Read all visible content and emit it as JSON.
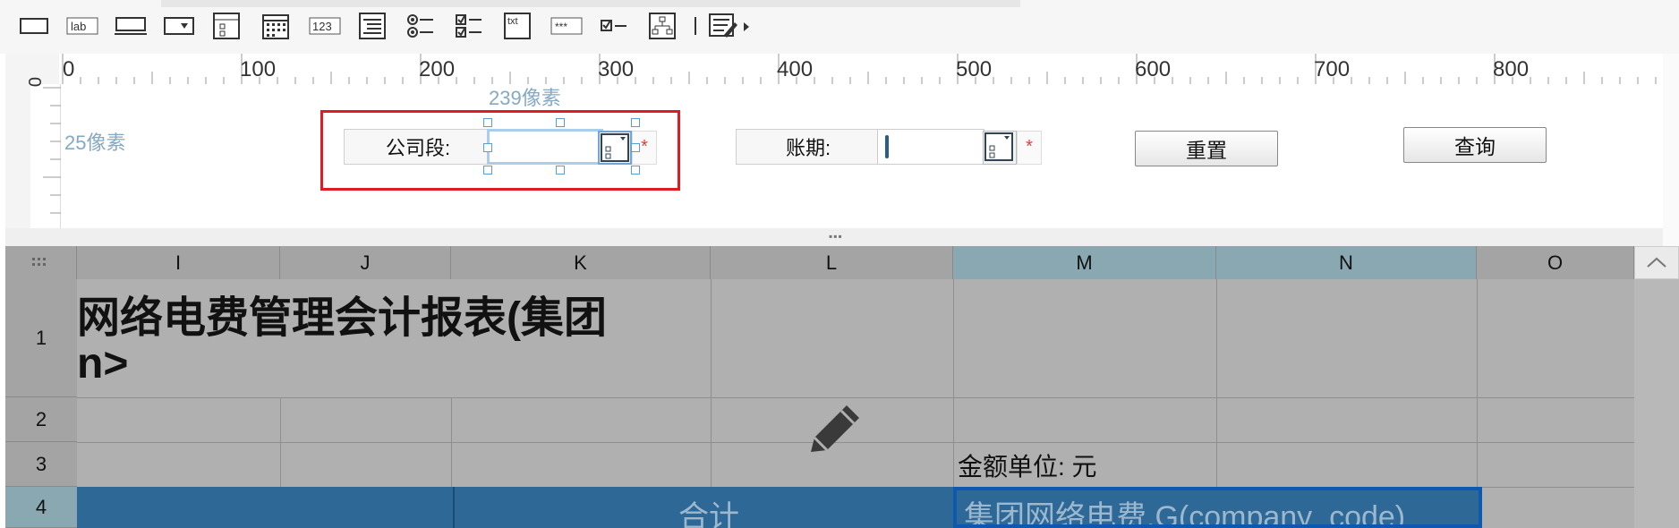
{
  "toolbar": {
    "buttons": [
      {
        "name": "rectangle-tool-button",
        "icon": "rectangle-icon"
      },
      {
        "name": "label-tool-button",
        "icon": "label-icon",
        "text": "lab"
      },
      {
        "name": "textbox-tool-button",
        "icon": "textbox-icon"
      },
      {
        "name": "dropdown-tool-button",
        "icon": "dropdown-icon"
      },
      {
        "name": "dropdown-tree-tool-button",
        "icon": "dropdown-tree-icon"
      },
      {
        "name": "date-tool-button",
        "icon": "calendar-icon"
      },
      {
        "name": "number-tool-button",
        "icon": "number-icon",
        "text": "123"
      },
      {
        "name": "list-tool-button",
        "icon": "list-icon"
      },
      {
        "name": "radio-group-tool-button",
        "icon": "radio-group-icon"
      },
      {
        "name": "checkbox-group-tool-button",
        "icon": "checkbox-group-icon"
      },
      {
        "name": "textarea-tool-button",
        "icon": "textarea-icon",
        "text": "txt"
      },
      {
        "name": "password-tool-button",
        "icon": "password-icon",
        "text": "***"
      },
      {
        "name": "checkbox-tool-button",
        "icon": "checkbox-icon"
      },
      {
        "name": "tree-tool-button",
        "icon": "tree-icon"
      },
      {
        "name": "more-tools-button",
        "icon": "edit-form-icon"
      }
    ]
  },
  "ruler": {
    "top_labels": [
      "0",
      "100",
      "200",
      "300",
      "400",
      "500",
      "600",
      "700",
      "800"
    ],
    "left_label": "0"
  },
  "design": {
    "dim_width": "239像素",
    "dim_height": "25像素",
    "company_label": "公司段:",
    "period_label": "账期:",
    "required_mark": "*",
    "reset_button": "重置",
    "query_button": "查询"
  },
  "grid": {
    "columns": [
      "I",
      "J",
      "K",
      "L",
      "M",
      "N",
      "O"
    ],
    "rows": [
      "1",
      "2",
      "3",
      "4"
    ],
    "title_line1": "网络电费管理会计报表(集团",
    "title_line2": "n>",
    "amount_unit": "金额单位: 元",
    "total_label": "合计",
    "formula_cell": "集团网络电费.G(company_code)"
  },
  "colors": {
    "selection_red": "#e01b24",
    "header_blue": "#2e6896",
    "selected_header": "#8aa8b2"
  }
}
